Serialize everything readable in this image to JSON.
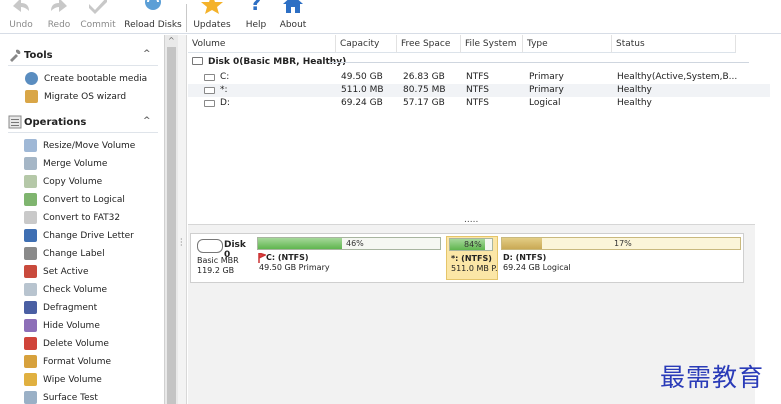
{
  "toolbar": {
    "buttons": [
      {
        "label": "Undo",
        "icon": "undo-arrow-icon",
        "enabled": false
      },
      {
        "label": "Redo",
        "icon": "redo-arrow-icon",
        "enabled": false
      },
      {
        "label": "Commit",
        "icon": "check-mark-icon",
        "enabled": false
      },
      {
        "label": "Reload Disks",
        "icon": "refresh-icon",
        "enabled": true
      },
      {
        "label": "Updates",
        "icon": "star-icon",
        "enabled": true
      },
      {
        "label": "Help",
        "icon": "question-icon",
        "enabled": true
      },
      {
        "label": "About",
        "icon": "home-icon",
        "enabled": true
      }
    ]
  },
  "sidebar": {
    "tools_header": "Tools",
    "tools": [
      {
        "label": "Create bootable media",
        "icon": "bootable-media-icon"
      },
      {
        "label": "Migrate OS wizard",
        "icon": "migrate-os-icon"
      }
    ],
    "operations_header": "Operations",
    "operations": [
      {
        "label": "Resize/Move Volume",
        "icon": "resize-icon"
      },
      {
        "label": "Merge Volume",
        "icon": "merge-icon"
      },
      {
        "label": "Copy Volume",
        "icon": "copy-icon"
      },
      {
        "label": "Convert to Logical",
        "icon": "convert-logical-icon"
      },
      {
        "label": "Convert to FAT32",
        "icon": "convert-fat32-icon"
      },
      {
        "label": "Change Drive Letter",
        "icon": "drive-letter-icon"
      },
      {
        "label": "Change Label",
        "icon": "label-icon"
      },
      {
        "label": "Set Active",
        "icon": "flag-icon"
      },
      {
        "label": "Check Volume",
        "icon": "check-volume-icon"
      },
      {
        "label": "Defragment",
        "icon": "defragment-icon"
      },
      {
        "label": "Hide Volume",
        "icon": "hide-icon"
      },
      {
        "label": "Delete Volume",
        "icon": "delete-icon"
      },
      {
        "label": "Format Volume",
        "icon": "format-icon"
      },
      {
        "label": "Wipe Volume",
        "icon": "wipe-icon"
      },
      {
        "label": "Surface Test",
        "icon": "surface-test-icon"
      }
    ]
  },
  "volume_table": {
    "columns": [
      "Volume",
      "Capacity",
      "Free Space",
      "File System",
      "Type",
      "Status"
    ],
    "disk_group": "Disk 0(Basic MBR, Healthy)",
    "rows": [
      {
        "volume": "C:",
        "capacity": "49.50 GB",
        "free": "26.83 GB",
        "fs": "NTFS",
        "type": "Primary",
        "status": "Healthy(Active,System,B..."
      },
      {
        "volume": "*:",
        "capacity": "511.0 MB",
        "free": "80.75 MB",
        "fs": "NTFS",
        "type": "Primary",
        "status": "Healthy"
      },
      {
        "volume": "D:",
        "capacity": "69.24 GB",
        "free": "57.17 GB",
        "fs": "NTFS",
        "type": "Logical",
        "status": "Healthy"
      }
    ],
    "more": "....."
  },
  "disk_map": {
    "disk_name": "Disk 0",
    "disk_type": "Basic MBR",
    "disk_size": "119.2 GB",
    "partitions": [
      {
        "name": "C: (NTFS)",
        "desc": "49.50 GB Primary",
        "used_pct": "46%",
        "used_fraction": 0.46
      },
      {
        "name": "*: (NTFS)",
        "desc": "511.0 MB P.",
        "used_pct": "84%",
        "used_fraction": 0.84
      },
      {
        "name": "D: (NTFS)",
        "desc": "69.24 GB Logical",
        "used_pct": "17%",
        "used_fraction": 0.17
      }
    ]
  },
  "watermark": "最需教育"
}
